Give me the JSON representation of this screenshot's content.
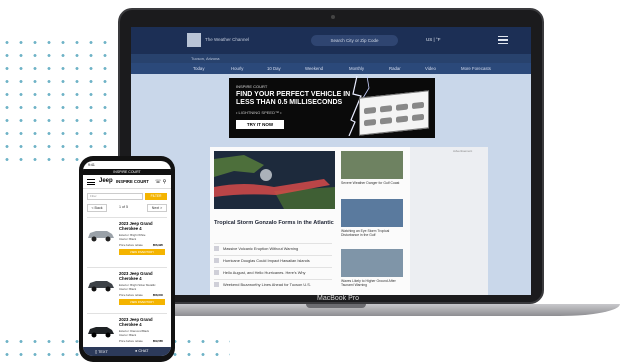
{
  "laptop": {
    "model_label": "MacBook Pro"
  },
  "weather_site": {
    "brand_label": "The Weather Channel",
    "search_placeholder": "Search City or Zip Code",
    "location": "US | °F",
    "subnav_text": "Tucson, Arizona",
    "tabs": [
      "Today",
      "Hourly",
      "10 Day",
      "Weekend",
      "Monthly",
      "Radar",
      "Video",
      "More Forecasts"
    ],
    "ad": {
      "brand": "INSPIRE COURT",
      "headline": "FIND YOUR PERFECT VEHICLE IN LESS THAN 0.5 MILLISECONDS",
      "tagline": "• LIGHTNING SPEED™ •",
      "button": "TRY IT NOW"
    },
    "sidebar_ad_label": "Advertisement",
    "headline": "Tropical Storm Gonzalo Forms in the Atlantic",
    "stories": [
      "Massive Volcanic Eruption Without Warning",
      "Hurricane Douglas Could Impact Hawaiian Islands",
      "Hello August, and Hello Hurricanes. Here's Why",
      "Weekend Buzzworthy Lines Ahead for Tucson U.S."
    ],
    "side_stories": [
      "Severe Weather Danger for Gulf Coast",
      "Watching an Eye Storm Tropical Disturbance in the Gulf",
      "Waves Likely to Higher Ground After Tsunami Warning"
    ]
  },
  "phone": {
    "time": "9:41",
    "top_banner": "INSPIRE COURT",
    "brand": "Jeep",
    "title": "INSPIRE COURT",
    "filter_placeholder": "Filter",
    "filter_button": "FILTER",
    "pager": {
      "back": "< Back",
      "count": "1 of 5",
      "next": "Next >"
    },
    "cards": [
      {
        "title": "2023 Jeep Grand Cherokee 4",
        "line1": "Exterior: Bright White",
        "line2": "Interior: Black",
        "price_label": "Price before rebate",
        "price": "$56,995",
        "button": "VIEW INVENTORY"
      },
      {
        "title": "2023 Jeep Grand Cherokee 4",
        "line1": "Exterior: Bright Silver Metallic",
        "line2": "Interior: Black",
        "price_label": "Price before rebate",
        "price": "$58,640",
        "button": "VIEW INVENTORY"
      },
      {
        "title": "2023 Jeep Grand Cherokee 4",
        "line1": "Exterior: Diamond Black",
        "line2": "Interior: Black",
        "price_label": "Price before rebate",
        "price": "$59,565",
        "button": "VIEW INVENTORY"
      }
    ],
    "bottom_bar": {
      "text_button": "TEXT",
      "chat_button": "CHAT"
    }
  }
}
